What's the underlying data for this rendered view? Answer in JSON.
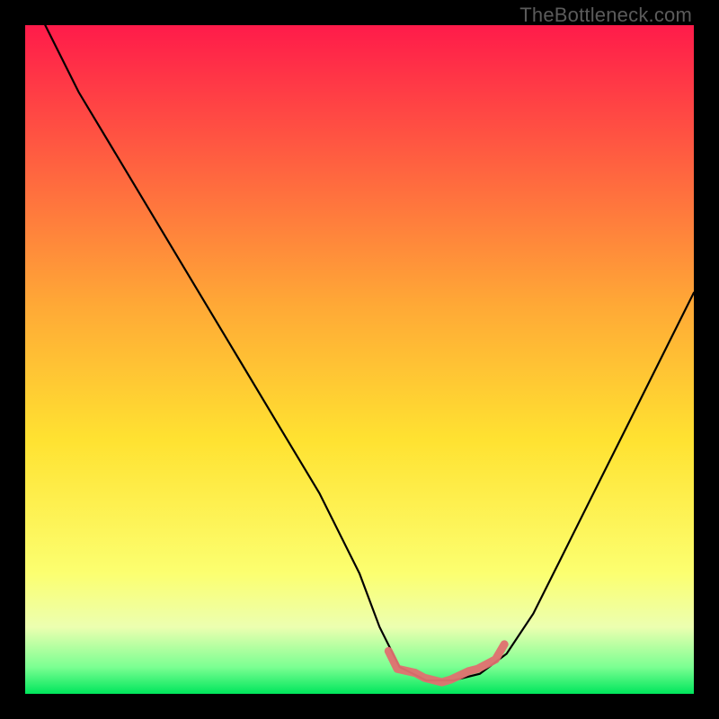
{
  "watermark": "TheBottleneck.com",
  "colors": {
    "bg": "#000000",
    "grad_top": "#ff1b4a",
    "grad_mid1": "#ffa936",
    "grad_mid2": "#ffe231",
    "grad_mid3": "#fcff70",
    "grad_bottom": "#00e65c",
    "curve": "#000000",
    "marker": "#e07070"
  },
  "chart_data": {
    "type": "line",
    "title": "",
    "xlabel": "",
    "ylabel": "",
    "xlim": [
      0,
      100
    ],
    "ylim": [
      0,
      100
    ],
    "series": [
      {
        "name": "bottleneck-curve",
        "x": [
          3,
          8,
          14,
          20,
          26,
          32,
          38,
          44,
          50,
          53,
          56,
          60,
          64,
          68,
          72,
          76,
          80,
          86,
          92,
          100
        ],
        "values": [
          100,
          90,
          80,
          70,
          60,
          50,
          40,
          30,
          18,
          10,
          4,
          2,
          2,
          3,
          6,
          12,
          20,
          32,
          44,
          60
        ]
      }
    ],
    "markers": {
      "name": "highlight-band",
      "x": [
        54,
        56,
        58,
        60,
        62,
        64,
        66,
        68,
        70,
        72
      ],
      "values": [
        6,
        4,
        3,
        2,
        2,
        2,
        3,
        4,
        5,
        7
      ]
    }
  }
}
